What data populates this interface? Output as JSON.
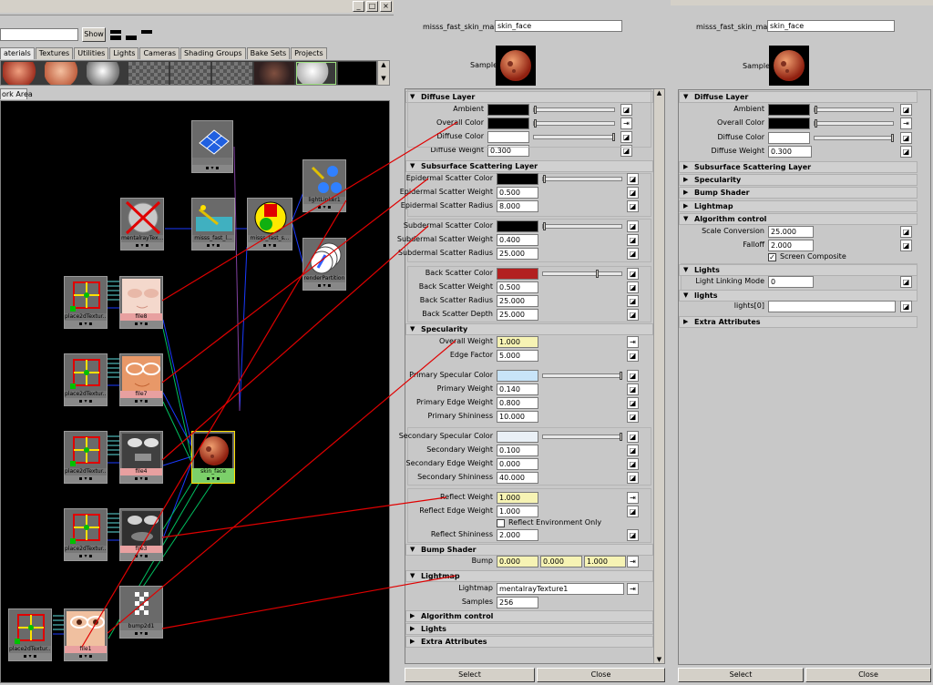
{
  "hypershade": {
    "show_label": "Show",
    "tabs": [
      "aterials",
      "Textures",
      "Utilities",
      "Lights",
      "Cameras",
      "Shading Groups",
      "Bake Sets",
      "Projects"
    ],
    "work_tab": "ork Area",
    "nodes": {
      "mentalray": "mentalrayTex...",
      "misss1": "misss_fast_l...",
      "misss2": "misss_fast_s...",
      "lightlinker": "lightLinker1",
      "renderpartition": "renderPartition",
      "place1": "place2dTextur...",
      "file8": "file8",
      "place2": "place2dTextur...",
      "file7": "file7",
      "place3": "place2dTextur...",
      "file4": "file4",
      "skin": "skin_face",
      "place4": "place2dTextur...",
      "file3": "file3",
      "place5": "place2dTextur...",
      "file1": "file1",
      "bump": "bump2d1"
    }
  },
  "ae1": {
    "node_label": "misss_fast_skin_maya:",
    "node_value": "skin_face",
    "sample_label": "Sample",
    "sections": {
      "diffuse": "Diffuse Layer",
      "subsurface": "Subsurface Scattering Layer",
      "specularity": "Specularity",
      "bump": "Bump Shader",
      "lightmap": "Lightmap",
      "algorithm": "Algorithm control",
      "lights": "Lights",
      "extra": "Extra Attributes"
    },
    "attrs": {
      "ambient": "Ambient",
      "overall_color": "Overall Color",
      "diffuse_color": "Diffuse Color",
      "diffuse_weight": "Diffuse Weight",
      "diffuse_weight_v": "0.300",
      "epi_color": "Epidermal Scatter Color",
      "epi_weight": "Epidermal Scatter Weight",
      "epi_weight_v": "0.500",
      "epi_radius": "Epidermal Scatter Radius",
      "epi_radius_v": "8.000",
      "sub_color": "Subdermal Scatter Color",
      "sub_weight": "Subdermal Scatter Weight",
      "sub_weight_v": "0.400",
      "sub_radius": "Subdermal Scatter Radius",
      "sub_radius_v": "25.000",
      "back_color": "Back Scatter Color",
      "back_weight": "Back Scatter Weight",
      "back_weight_v": "0.500",
      "back_radius": "Back Scatter Radius",
      "back_radius_v": "25.000",
      "back_depth": "Back Scatter Depth",
      "back_depth_v": "25.000",
      "overall_weight": "Overall Weight",
      "overall_weight_v": "1.000",
      "edge_factor": "Edge Factor",
      "edge_factor_v": "5.000",
      "prim_color": "Primary Specular Color",
      "prim_weight": "Primary Weight",
      "prim_weight_v": "0.140",
      "prim_edge": "Primary Edge Weight",
      "prim_edge_v": "0.800",
      "prim_shin": "Primary Shininess",
      "prim_shin_v": "10.000",
      "sec_color": "Secondary Specular Color",
      "sec_weight": "Secondary Weight",
      "sec_weight_v": "0.100",
      "sec_edge": "Secondary Edge Weight",
      "sec_edge_v": "0.000",
      "sec_shin": "Secondary Shininess",
      "sec_shin_v": "40.000",
      "refl_weight": "Reflect Weight",
      "refl_weight_v": "1.000",
      "refl_edge": "Reflect Edge Weight",
      "refl_edge_v": "1.000",
      "refl_env": "Reflect Environment Only",
      "refl_shin": "Reflect Shininess",
      "refl_shin_v": "2.000",
      "bump": "Bump",
      "bump_v1": "0.000",
      "bump_v2": "0.000",
      "bump_v3": "1.000",
      "lightmap": "Lightmap",
      "lightmap_v": "mentalrayTexture1",
      "samples": "Samples",
      "samples_v": "256"
    },
    "select": "Select",
    "close": "Close"
  },
  "ae2": {
    "node_label": "misss_fast_skin_maya:",
    "node_value": "skin_face",
    "sample_label": "Sample",
    "sections": {
      "diffuse": "Diffuse Layer",
      "subsurface": "Subsurface Scattering Layer",
      "specularity": "Specularity",
      "bump": "Bump Shader",
      "lightmap": "Lightmap",
      "algorithm": "Algorithm control",
      "lights": "Lights",
      "lights_lower": "lights",
      "extra": "Extra Attributes"
    },
    "attrs": {
      "ambient": "Ambient",
      "overall_color": "Overall Color",
      "diffuse_color": "Diffuse Color",
      "diffuse_weight": "Diffuse Weight",
      "diffuse_weight_v": "0.300",
      "scale_conv": "Scale Conversion",
      "scale_conv_v": "25.000",
      "falloff": "Falloff",
      "falloff_v": "2.000",
      "screen_comp": "Screen Composite",
      "light_link": "Light Linking Mode",
      "light_link_v": "0",
      "lights0": "lights[0]"
    },
    "select": "Select",
    "close": "Close"
  },
  "colors": {
    "wire_red": "#e00000",
    "back_scatter": "#b22020",
    "overall_weight_field": "#f6f3b4",
    "specular": "#c8e4f8"
  }
}
